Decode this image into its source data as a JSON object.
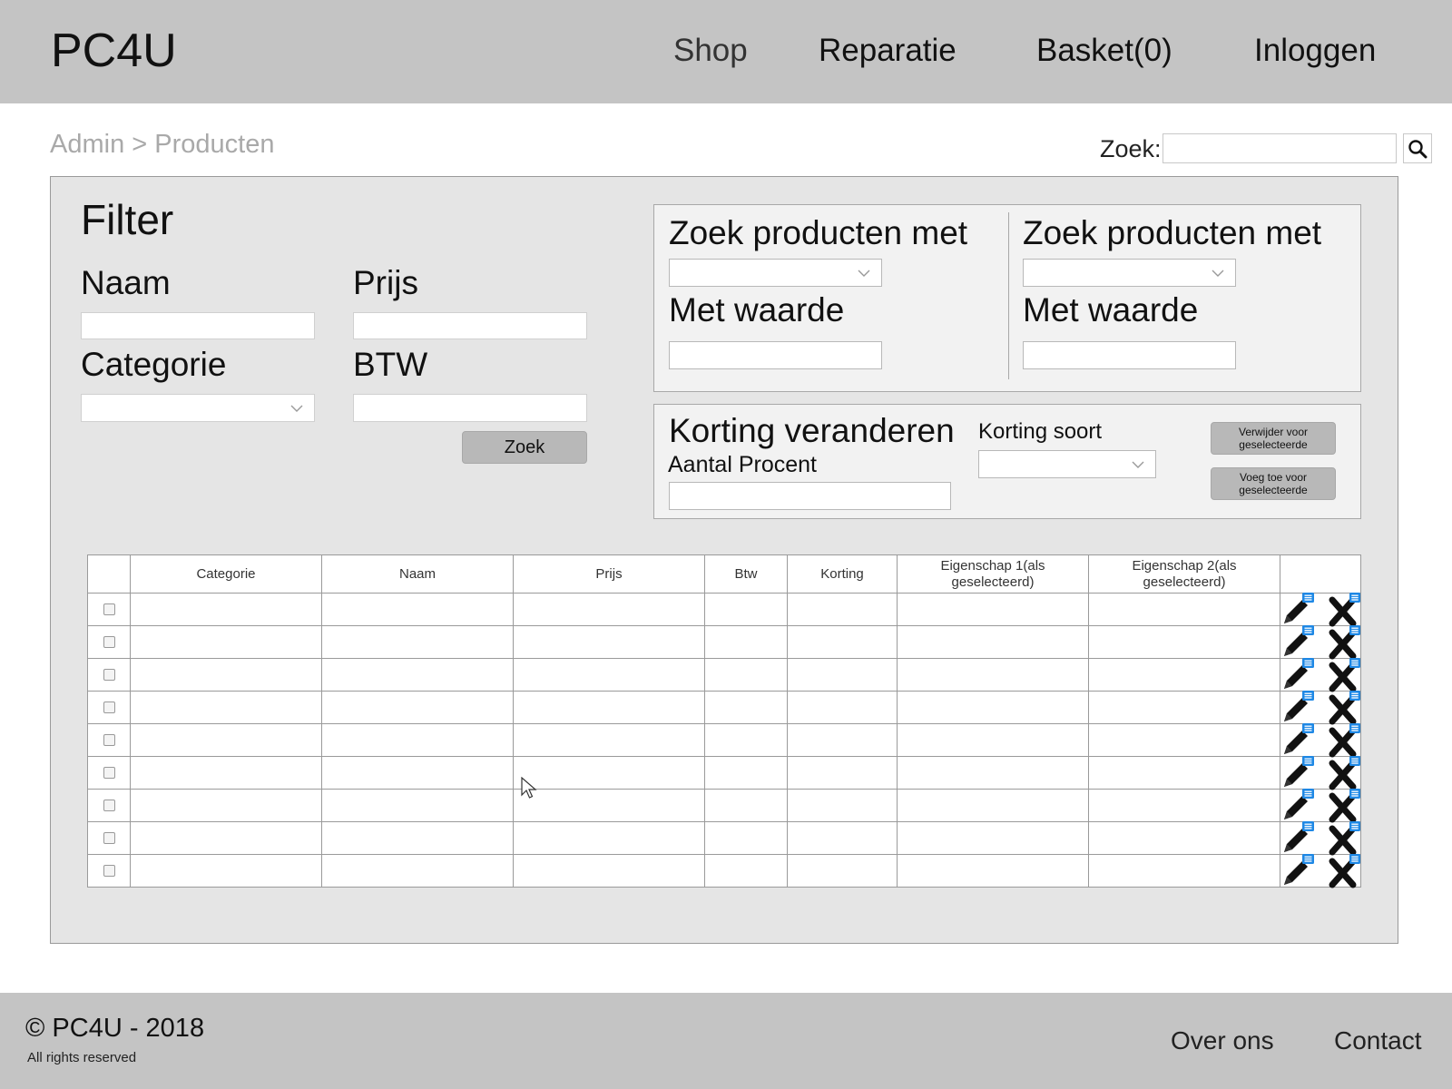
{
  "header": {
    "logo": "PC4U",
    "nav": {
      "shop": "Shop",
      "reparatie": "Reparatie",
      "basket": "Basket(0)",
      "login": "Inloggen"
    }
  },
  "breadcrumb": "Admin > Producten",
  "search": {
    "label": "Zoek:",
    "value": ""
  },
  "filter": {
    "title": "Filter",
    "naam_label": "Naam",
    "prijs_label": "Prijs",
    "categorie_label": "Categorie",
    "btw_label": "BTW",
    "zoek_button": "Zoek"
  },
  "property_search": {
    "left": {
      "label": "Zoek producten met",
      "value_label": "Met waarde"
    },
    "right": {
      "label": "Zoek producten met",
      "value_label": "Met waarde"
    }
  },
  "discount": {
    "title": "Korting veranderen",
    "percent_label": "Aantal Procent",
    "type_label": "Korting soort",
    "remove_button": "Verwijder voor geselecteerde",
    "add_button": "Voeg toe voor geselecteerde"
  },
  "table": {
    "columns": [
      "",
      "Categorie",
      "Naam",
      "Prijs",
      "Btw",
      "Korting",
      "Eigenschap 1(als geselecteerd)",
      "Eigenschap 2(als geselecteerd)",
      ""
    ],
    "row_count": 9
  },
  "icons": {
    "search": "search-icon",
    "edit": "pencil-edit-icon",
    "delete": "delete-x-icon",
    "dropdown": "chevron-down-icon"
  },
  "colors": {
    "header_bg": "#c4c4c4",
    "panel_bg": "#e5e5e5",
    "note_badge": "#1e88e5"
  },
  "footer": {
    "copyright": "© PC4U - 2018",
    "rights": "All rights reserved",
    "about": "Over ons",
    "contact": "Contact"
  }
}
